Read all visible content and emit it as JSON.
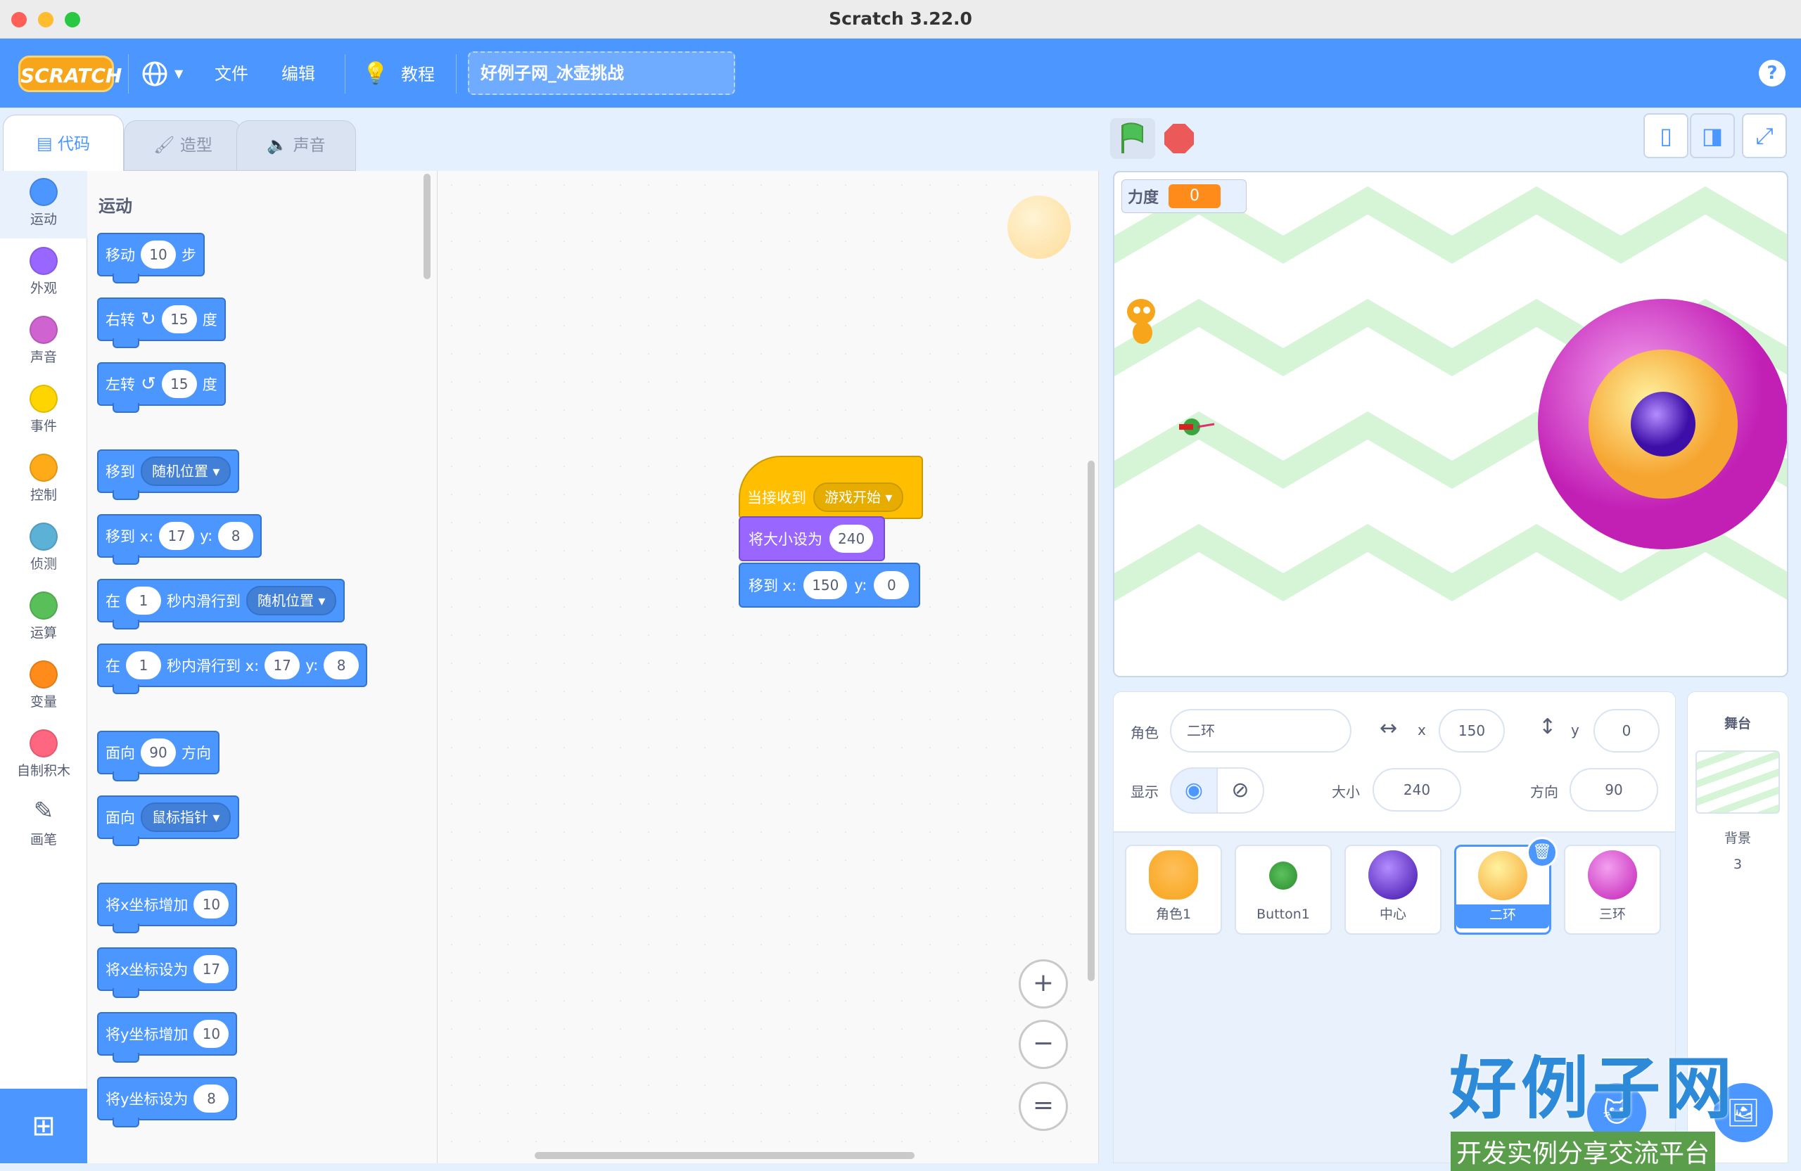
{
  "window": {
    "title": "Scratch 3.22.0"
  },
  "menubar": {
    "logo": "SCRATCH",
    "file": "文件",
    "edit": "编辑",
    "tutorials": "教程",
    "project_title": "好例子网_冰壶挑战",
    "help": "?"
  },
  "tabs": {
    "code": "代码",
    "costumes": "造型",
    "sounds": "声音"
  },
  "categories": [
    {
      "label": "运动",
      "color": "#4c97ff"
    },
    {
      "label": "外观",
      "color": "#9966ff"
    },
    {
      "label": "声音",
      "color": "#cf63cf"
    },
    {
      "label": "事件",
      "color": "#ffd500"
    },
    {
      "label": "控制",
      "color": "#ffab19"
    },
    {
      "label": "侦测",
      "color": "#5cb1d6"
    },
    {
      "label": "运算",
      "color": "#59c059"
    },
    {
      "label": "变量",
      "color": "#ff8c1a"
    },
    {
      "label": "自制积木",
      "color": "#ff6680"
    },
    {
      "label": "画笔",
      "color": "#0fbd8c"
    }
  ],
  "palette": {
    "section": "运动",
    "move": {
      "label": "移动",
      "value": "10",
      "unit": "步"
    },
    "turn_right": {
      "label": "右转",
      "value": "15",
      "unit": "度"
    },
    "turn_left": {
      "label": "左转",
      "value": "15",
      "unit": "度"
    },
    "goto": {
      "label": "移到",
      "menu": "随机位置"
    },
    "goto_xy": {
      "label": "移到 x:",
      "x": "17",
      "ylabel": "y:",
      "y": "8"
    },
    "glide_to": {
      "label": "在",
      "secs": "1",
      "mid": "秒内滑行到",
      "menu": "随机位置"
    },
    "glide_xy": {
      "label": "在",
      "secs": "1",
      "mid": "秒内滑行到 x:",
      "x": "17",
      "ylabel": "y:",
      "y": "8"
    },
    "point_dir": {
      "label": "面向",
      "value": "90",
      "unit": "方向"
    },
    "point_towards": {
      "label": "面向",
      "menu": "鼠标指针"
    },
    "change_x": {
      "label": "将x坐标增加",
      "value": "10"
    },
    "set_x": {
      "label": "将x坐标设为",
      "value": "17"
    },
    "change_y": {
      "label": "将y坐标增加",
      "value": "10"
    },
    "set_y": {
      "label": "将y坐标设为",
      "value": "8"
    }
  },
  "script": {
    "hat": {
      "label": "当接收到",
      "menu": "游戏开始"
    },
    "set_size": {
      "label": "将大小设为",
      "value": "240"
    },
    "goto_xy": {
      "label": "移到 x:",
      "x": "150",
      "ylabel": "y:",
      "y": "0"
    }
  },
  "zoom": {
    "in": "+",
    "out": "−",
    "reset": "="
  },
  "stage": {
    "monitor_label": "力度",
    "monitor_value": "0"
  },
  "sprite_info": {
    "sprite_label": "角色",
    "sprite_name": "二环",
    "x_label": "x",
    "x": "150",
    "y_label": "y",
    "y": "0",
    "show_label": "显示",
    "size_label": "大小",
    "size": "240",
    "direction_label": "方向",
    "direction": "90"
  },
  "sprites": [
    {
      "name": "角色1"
    },
    {
      "name": "Button1"
    },
    {
      "name": "中心"
    },
    {
      "name": "二环",
      "selected": true
    },
    {
      "name": "三环"
    }
  ],
  "stage_panel": {
    "title": "舞台",
    "backdrops_label": "背景",
    "backdrops_count": "3"
  },
  "watermark": {
    "big": "好例子网",
    "small": "开发实例分享交流平台"
  }
}
